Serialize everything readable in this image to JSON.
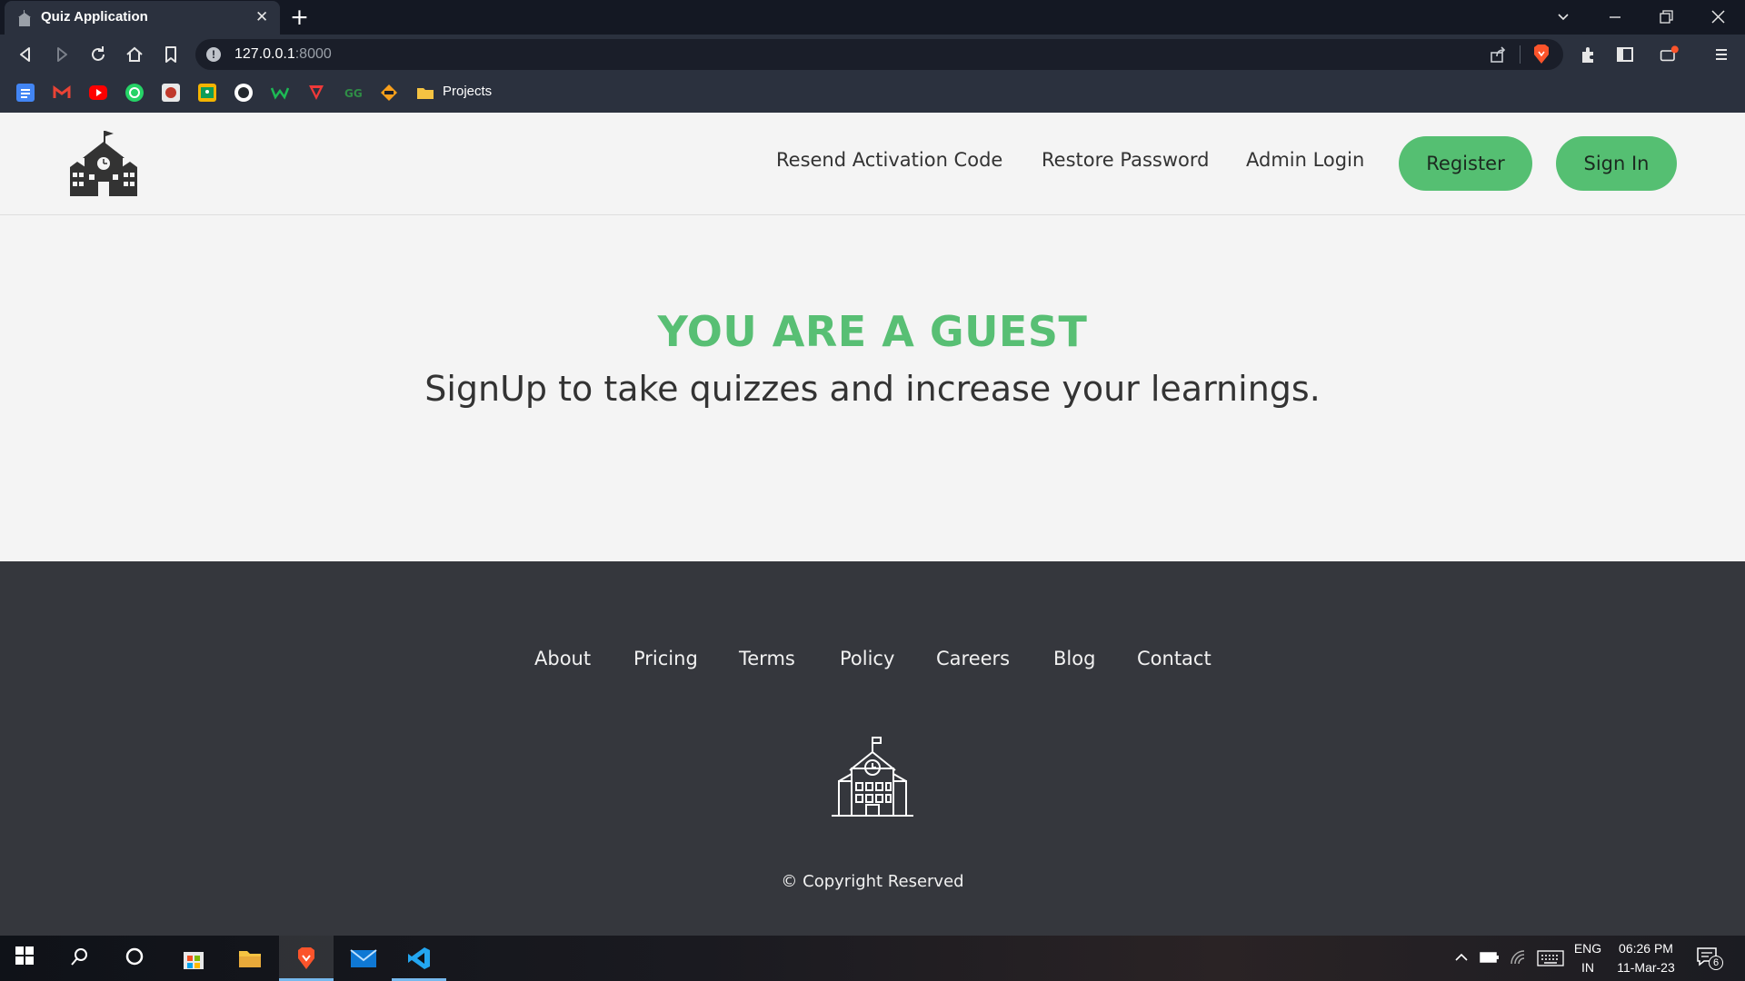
{
  "browser": {
    "tab_title": "Quiz Application",
    "tab_close": "✕",
    "new_tab": "+",
    "url_host": "127.0.0.1",
    "url_port": ":8000",
    "bookmark_folder": "Projects"
  },
  "site": {
    "nav": {
      "resend": "Resend Activation Code",
      "restore": "Restore Password",
      "admin": "Admin Login",
      "register": "Register",
      "signin": "Sign In"
    },
    "hero": {
      "title": "YOU ARE A GUEST",
      "subtitle": "SignUp to take quizzes and increase your learnings."
    },
    "footer": {
      "links": [
        "About",
        "Pricing",
        "Terms",
        "Policy",
        "Careers",
        "Blog",
        "Contact"
      ],
      "copyright": "© Copyright Reserved"
    },
    "colors": {
      "accent": "#55bf72",
      "footer_bg": "#35373d",
      "page_bg": "#f4f4f4"
    }
  },
  "taskbar": {
    "lang_top": "ENG",
    "lang_bottom": "IN",
    "time": "06:26 PM",
    "date": "11-Mar-23",
    "notification_count": "6"
  }
}
